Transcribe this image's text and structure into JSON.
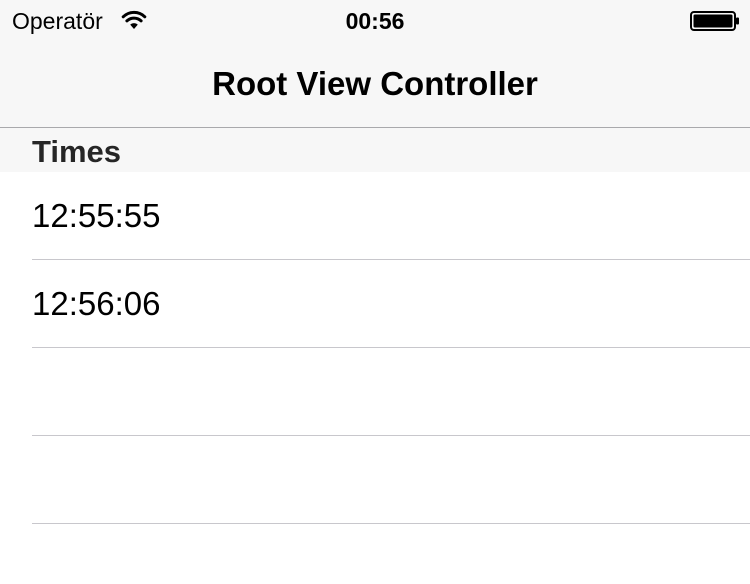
{
  "status_bar": {
    "carrier": "Operatör",
    "time": "00:56",
    "wifi_icon": "wifi-icon",
    "battery_icon": "battery-icon"
  },
  "nav": {
    "title": "Root View Controller"
  },
  "table": {
    "section_title": "Times",
    "rows": [
      {
        "label": "12:55:55"
      },
      {
        "label": "12:56:06"
      },
      {
        "label": ""
      },
      {
        "label": ""
      }
    ]
  }
}
